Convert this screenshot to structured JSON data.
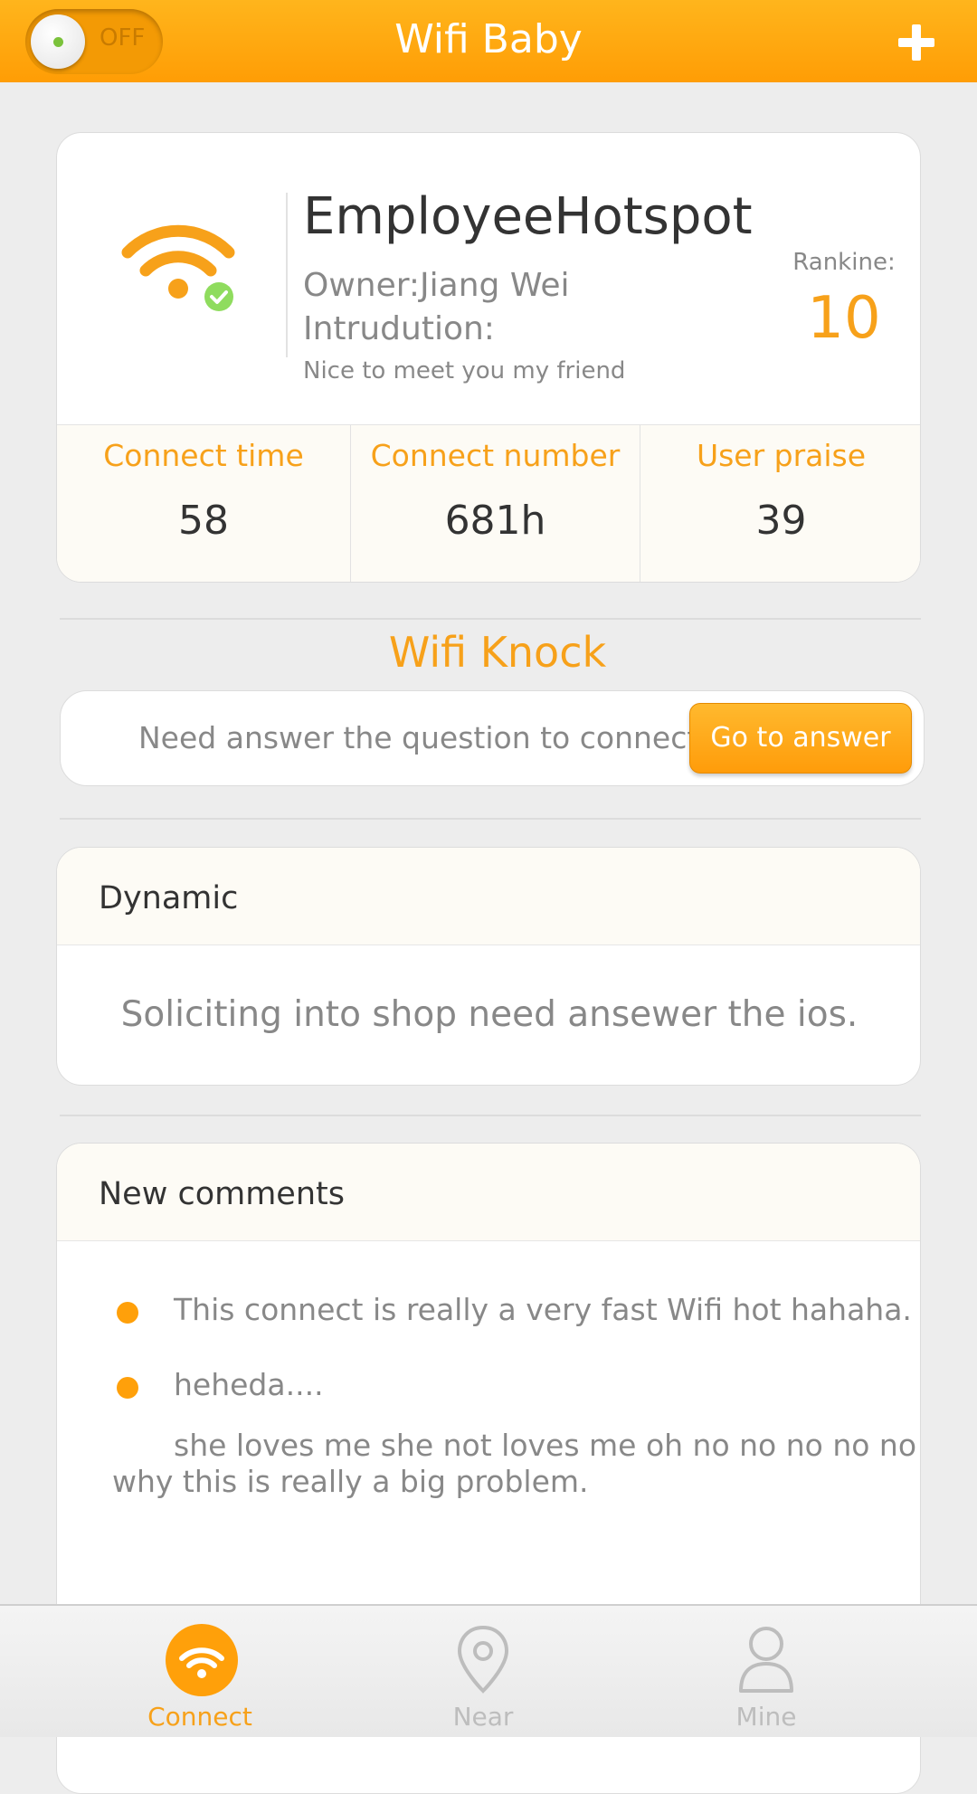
{
  "header": {
    "title": "Wifi Baby",
    "toggle_label": "OFF",
    "add_icon": "plus-icon"
  },
  "hotspot": {
    "name": "EmployeeHotspot",
    "owner": "Owner:Jiang Wei",
    "intro_label": "Intrudution:",
    "intro": "Nice to meet you my friend",
    "rank_label": "Rankine:",
    "rank_value": "10",
    "icon": "wifi-connected-icon"
  },
  "stats": [
    {
      "label": "Connect time",
      "value": "58"
    },
    {
      "label": "Connect number",
      "value": "681h"
    },
    {
      "label": "User praise",
      "value": "39"
    }
  ],
  "knock": {
    "title": "Wifi Knock",
    "text": "Need answer the question to connect",
    "button": "Go to answer"
  },
  "dynamic": {
    "title": "Dynamic",
    "text": "Soliciting into shop need ansewer the ios."
  },
  "comments": {
    "title": "New comments",
    "items": [
      "This connect is really a very fast Wifi hot hahaha.",
      "heheda....",
      "she loves me she not loves me oh no no no no no",
      "why this is really a big problem."
    ]
  },
  "nav": [
    {
      "label": "Connect",
      "icon": "wifi-icon",
      "active": true
    },
    {
      "label": "Near",
      "icon": "location-pin-icon",
      "active": false
    },
    {
      "label": "Mine",
      "icon": "user-icon",
      "active": false
    }
  ],
  "colors": {
    "accent": "#ffa00a",
    "accent_text": "#f7a11a",
    "inactive": "#bdbdbd",
    "success": "#8fdc5e"
  }
}
